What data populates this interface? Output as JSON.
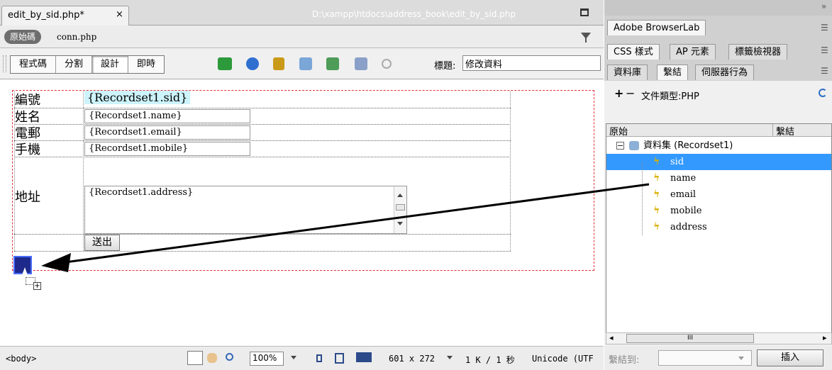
{
  "document": {
    "tab_label": "edit_by_sid.php*",
    "tab_close": "×",
    "file_path": "D:\\xampp\\htdocs\\address_book\\edit_by_sid.php",
    "source_code_label": "原始碼",
    "related_file": "conn.php",
    "view_buttons": [
      "程式碼",
      "分割",
      "設計",
      "即時"
    ],
    "title_label": "標題:",
    "title_value": "修改資料"
  },
  "form": {
    "labels": {
      "sid": "編號",
      "name": "姓名",
      "email": "電郵",
      "mobile": "手機",
      "address": "地址"
    },
    "sid_value": "{Recordset1.sid}",
    "name_value": "{Recordset1.name}",
    "email_value": "{Recordset1.email}",
    "mobile_value": "{Recordset1.mobile}",
    "address_value": "{Recordset1.address}",
    "submit_label": "送出"
  },
  "status_bar": {
    "tag": "<body>",
    "zoom": "100%",
    "dimensions": "601 x 272",
    "size_time": "1 K / 1 秒",
    "encoding": "Unicode (UTF"
  },
  "panels": {
    "browserlab_tab": "Adobe BrowserLab",
    "group2_tabs": [
      "CSS 樣式",
      "AP 元素",
      "標籤檢視器"
    ],
    "group3_tabs": [
      "資料庫",
      "繫結",
      "伺服器行為"
    ],
    "doc_type": "文件類型:PHP",
    "add_symbol": "+",
    "remove_symbol": "−",
    "col_source": "原始",
    "col_binding": "繫結",
    "recordset_label": "資料集 (Recordset1)",
    "fields": [
      "sid",
      "name",
      "email",
      "mobile",
      "address"
    ],
    "selected_field": "sid",
    "bind_to_label": "繫結到:",
    "insert_label": "插入",
    "scroll_thumb": "III"
  },
  "colors": {
    "selection": "#3399ff",
    "form_outline": "#e0303a",
    "dynamic_text_bg": "#cdf3fb"
  }
}
